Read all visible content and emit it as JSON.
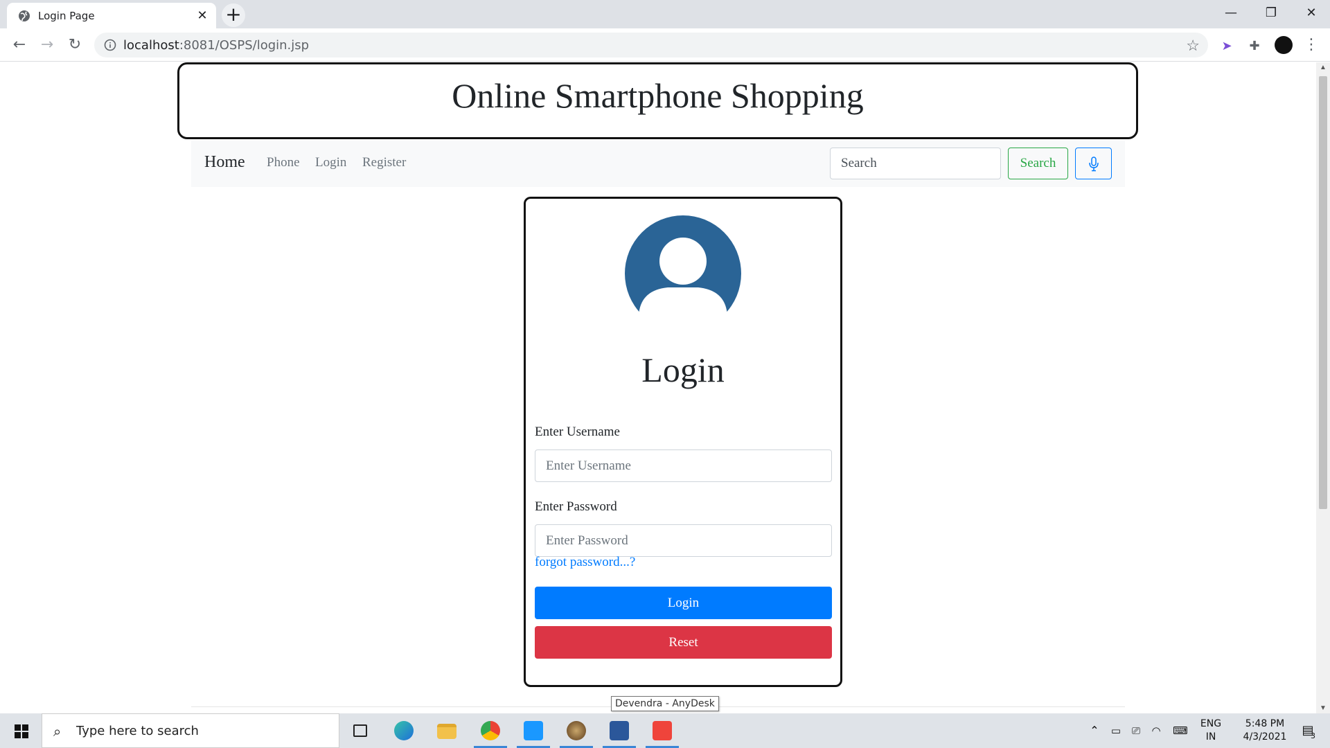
{
  "browser": {
    "tab_title": "Login Page",
    "url_host": "localhost",
    "url_path": ":8081/OSPS/login.jsp"
  },
  "page": {
    "site_title": "Online Smartphone Shopping",
    "nav": {
      "brand": "Home",
      "links": [
        "Phone",
        "Login",
        "Register"
      ],
      "search_placeholder": "Search",
      "search_button": "Search"
    },
    "login": {
      "heading": "Login",
      "username_label": "Enter Username",
      "username_placeholder": "Enter Username",
      "password_label": "Enter Password",
      "password_placeholder": "Enter Password",
      "forgot_link": "forgot password...?",
      "login_button": "Login",
      "reset_button": "Reset"
    },
    "tooltip": "Devendra - AnyDesk"
  },
  "taskbar": {
    "search_placeholder": "Type here to search",
    "lang_top": "ENG",
    "lang_bottom": "IN",
    "time": "5:48 PM",
    "date": "4/3/2021",
    "notifications": "3"
  },
  "colors": {
    "primary": "#007bff",
    "success": "#28a745",
    "danger": "#dc3545",
    "avatar": "#2a6496"
  }
}
